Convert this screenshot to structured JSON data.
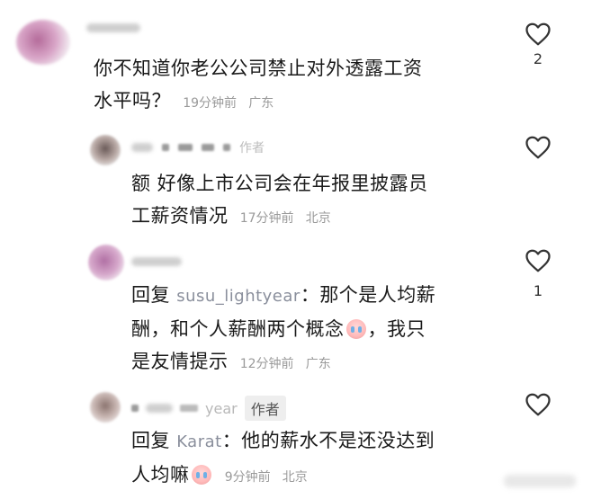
{
  "comments": [
    {
      "text_line1": "你不知道你老公公司禁止对外透露工资",
      "text_line2": "水平吗？",
      "time": "19分钟前",
      "location": "广东",
      "likes": "2"
    },
    {
      "author_tag": "作者",
      "text_line1": "额 好像上市公司会在年报里披露员",
      "text_line2": "工薪资情况",
      "time": "17分钟前",
      "location": "北京",
      "likes": ""
    },
    {
      "reply_label": "回复",
      "reply_to": "susu_lightyear",
      "colon": "：",
      "text_line1_after": "那个是人均薪",
      "text_line2_before": "酬，和个人薪酬两个概念",
      "text_line2_after": "，我只",
      "text_line3": "是友情提示",
      "time": "12分钟前",
      "location": "广东",
      "likes": "1"
    },
    {
      "name_fragment": "year",
      "author_tag": "作者",
      "reply_label": "回复",
      "reply_to": "Karat",
      "colon": "：",
      "text_line1_after": "他的薪水不是还没达到",
      "text_line2": "人均嘛",
      "time": "9分钟前",
      "location": "北京",
      "likes": ""
    }
  ],
  "icons": {
    "like": "heart-outline-icon",
    "emoji": "crying-face-emoji-icon"
  },
  "colors": {
    "text": "#1a1a1a",
    "meta": "#9a9a9a",
    "reply_name": "#8a8f9c"
  }
}
